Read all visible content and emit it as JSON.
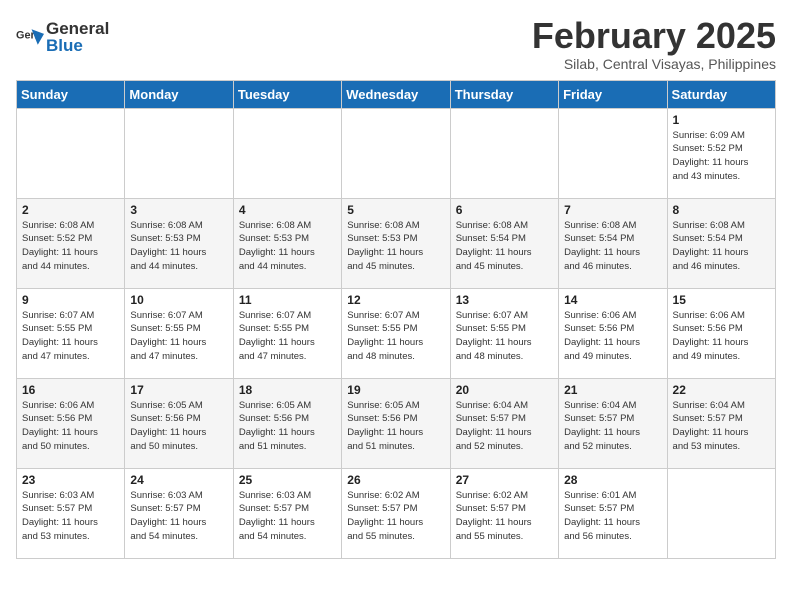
{
  "header": {
    "logo_general": "General",
    "logo_blue": "Blue",
    "month": "February 2025",
    "location": "Silab, Central Visayas, Philippines"
  },
  "weekdays": [
    "Sunday",
    "Monday",
    "Tuesday",
    "Wednesday",
    "Thursday",
    "Friday",
    "Saturday"
  ],
  "weeks": [
    [
      {
        "day": "",
        "info": ""
      },
      {
        "day": "",
        "info": ""
      },
      {
        "day": "",
        "info": ""
      },
      {
        "day": "",
        "info": ""
      },
      {
        "day": "",
        "info": ""
      },
      {
        "day": "",
        "info": ""
      },
      {
        "day": "1",
        "info": "Sunrise: 6:09 AM\nSunset: 5:52 PM\nDaylight: 11 hours\nand 43 minutes."
      }
    ],
    [
      {
        "day": "2",
        "info": "Sunrise: 6:08 AM\nSunset: 5:52 PM\nDaylight: 11 hours\nand 44 minutes."
      },
      {
        "day": "3",
        "info": "Sunrise: 6:08 AM\nSunset: 5:53 PM\nDaylight: 11 hours\nand 44 minutes."
      },
      {
        "day": "4",
        "info": "Sunrise: 6:08 AM\nSunset: 5:53 PM\nDaylight: 11 hours\nand 44 minutes."
      },
      {
        "day": "5",
        "info": "Sunrise: 6:08 AM\nSunset: 5:53 PM\nDaylight: 11 hours\nand 45 minutes."
      },
      {
        "day": "6",
        "info": "Sunrise: 6:08 AM\nSunset: 5:54 PM\nDaylight: 11 hours\nand 45 minutes."
      },
      {
        "day": "7",
        "info": "Sunrise: 6:08 AM\nSunset: 5:54 PM\nDaylight: 11 hours\nand 46 minutes."
      },
      {
        "day": "8",
        "info": "Sunrise: 6:08 AM\nSunset: 5:54 PM\nDaylight: 11 hours\nand 46 minutes."
      }
    ],
    [
      {
        "day": "9",
        "info": "Sunrise: 6:07 AM\nSunset: 5:55 PM\nDaylight: 11 hours\nand 47 minutes."
      },
      {
        "day": "10",
        "info": "Sunrise: 6:07 AM\nSunset: 5:55 PM\nDaylight: 11 hours\nand 47 minutes."
      },
      {
        "day": "11",
        "info": "Sunrise: 6:07 AM\nSunset: 5:55 PM\nDaylight: 11 hours\nand 47 minutes."
      },
      {
        "day": "12",
        "info": "Sunrise: 6:07 AM\nSunset: 5:55 PM\nDaylight: 11 hours\nand 48 minutes."
      },
      {
        "day": "13",
        "info": "Sunrise: 6:07 AM\nSunset: 5:55 PM\nDaylight: 11 hours\nand 48 minutes."
      },
      {
        "day": "14",
        "info": "Sunrise: 6:06 AM\nSunset: 5:56 PM\nDaylight: 11 hours\nand 49 minutes."
      },
      {
        "day": "15",
        "info": "Sunrise: 6:06 AM\nSunset: 5:56 PM\nDaylight: 11 hours\nand 49 minutes."
      }
    ],
    [
      {
        "day": "16",
        "info": "Sunrise: 6:06 AM\nSunset: 5:56 PM\nDaylight: 11 hours\nand 50 minutes."
      },
      {
        "day": "17",
        "info": "Sunrise: 6:05 AM\nSunset: 5:56 PM\nDaylight: 11 hours\nand 50 minutes."
      },
      {
        "day": "18",
        "info": "Sunrise: 6:05 AM\nSunset: 5:56 PM\nDaylight: 11 hours\nand 51 minutes."
      },
      {
        "day": "19",
        "info": "Sunrise: 6:05 AM\nSunset: 5:56 PM\nDaylight: 11 hours\nand 51 minutes."
      },
      {
        "day": "20",
        "info": "Sunrise: 6:04 AM\nSunset: 5:57 PM\nDaylight: 11 hours\nand 52 minutes."
      },
      {
        "day": "21",
        "info": "Sunrise: 6:04 AM\nSunset: 5:57 PM\nDaylight: 11 hours\nand 52 minutes."
      },
      {
        "day": "22",
        "info": "Sunrise: 6:04 AM\nSunset: 5:57 PM\nDaylight: 11 hours\nand 53 minutes."
      }
    ],
    [
      {
        "day": "23",
        "info": "Sunrise: 6:03 AM\nSunset: 5:57 PM\nDaylight: 11 hours\nand 53 minutes."
      },
      {
        "day": "24",
        "info": "Sunrise: 6:03 AM\nSunset: 5:57 PM\nDaylight: 11 hours\nand 54 minutes."
      },
      {
        "day": "25",
        "info": "Sunrise: 6:03 AM\nSunset: 5:57 PM\nDaylight: 11 hours\nand 54 minutes."
      },
      {
        "day": "26",
        "info": "Sunrise: 6:02 AM\nSunset: 5:57 PM\nDaylight: 11 hours\nand 55 minutes."
      },
      {
        "day": "27",
        "info": "Sunrise: 6:02 AM\nSunset: 5:57 PM\nDaylight: 11 hours\nand 55 minutes."
      },
      {
        "day": "28",
        "info": "Sunrise: 6:01 AM\nSunset: 5:57 PM\nDaylight: 11 hours\nand 56 minutes."
      },
      {
        "day": "",
        "info": ""
      }
    ]
  ]
}
